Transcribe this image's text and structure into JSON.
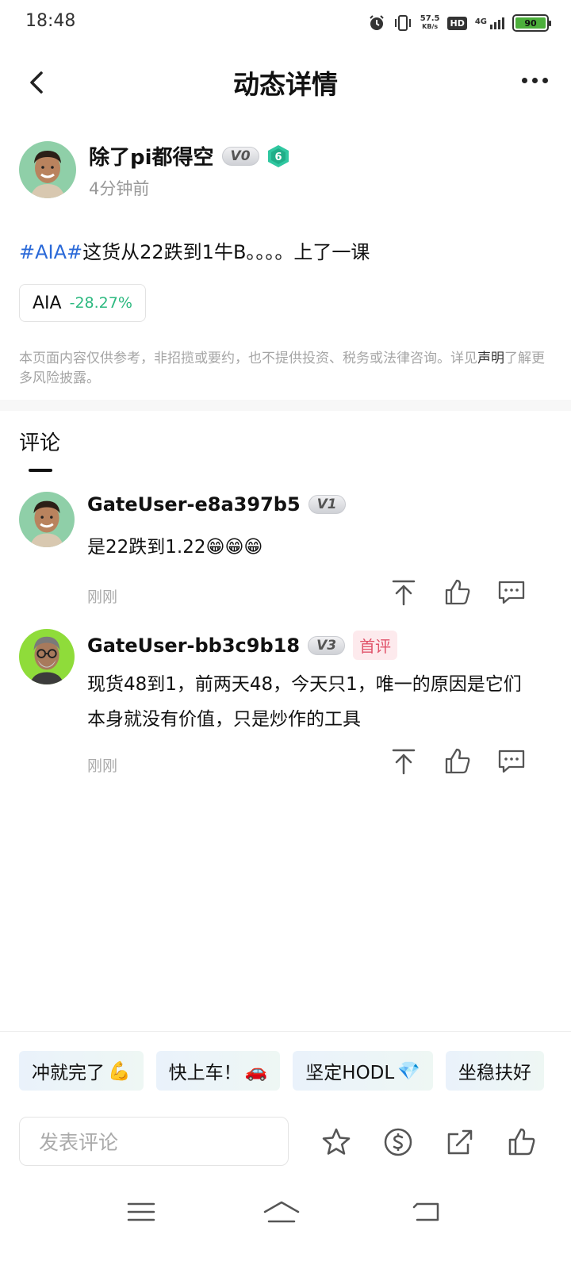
{
  "status_bar": {
    "time": "18:48",
    "net_speed_value": "57.5",
    "net_speed_unit": "KB/s",
    "hd_label": "HD",
    "network": "4G",
    "battery": "90"
  },
  "header": {
    "title": "动态详情"
  },
  "post": {
    "author_name": "除了pi都得空",
    "author_vip": "V0",
    "author_level": "6",
    "time": "4分钟前",
    "hashtag": "#AIA#",
    "text": "这货从22跌到1牛B。。。。上了一课",
    "ticker": {
      "symbol": "AIA",
      "change": "-28.27%"
    },
    "disclaimer_pre": "本页面内容仅供参考，非招揽或要约，也不提供投资、税务或法律咨询。详见",
    "disclaimer_link": "声明",
    "disclaimer_post": "了解更多风险披露。"
  },
  "comments_section": {
    "tab_label": "评论",
    "items": [
      {
        "user": "GateUser-e8a397b5",
        "vip": "V1",
        "tag": "",
        "text": "是22跌到1.22😁😁😁",
        "time": "刚刚"
      },
      {
        "user": "GateUser-bb3c9b18",
        "vip": "V3",
        "tag": "首评",
        "text": "现货48到1，前两天48，今天只1，唯一的原因是它们本身就没有价值，只是炒作的工具",
        "time": "刚刚"
      }
    ]
  },
  "quick_replies": [
    {
      "text": "冲就完了",
      "emoji": "💪"
    },
    {
      "text": "快上车！",
      "emoji": "🚗"
    },
    {
      "text": "坚定HODL",
      "emoji": "💎"
    },
    {
      "text": "坐稳扶好",
      "emoji": ""
    }
  ],
  "composer": {
    "placeholder": "发表评论"
  },
  "colors": {
    "hashtag": "#2a69d8",
    "change_positive_green": "#2db980",
    "first_tag": "#e0536a"
  }
}
